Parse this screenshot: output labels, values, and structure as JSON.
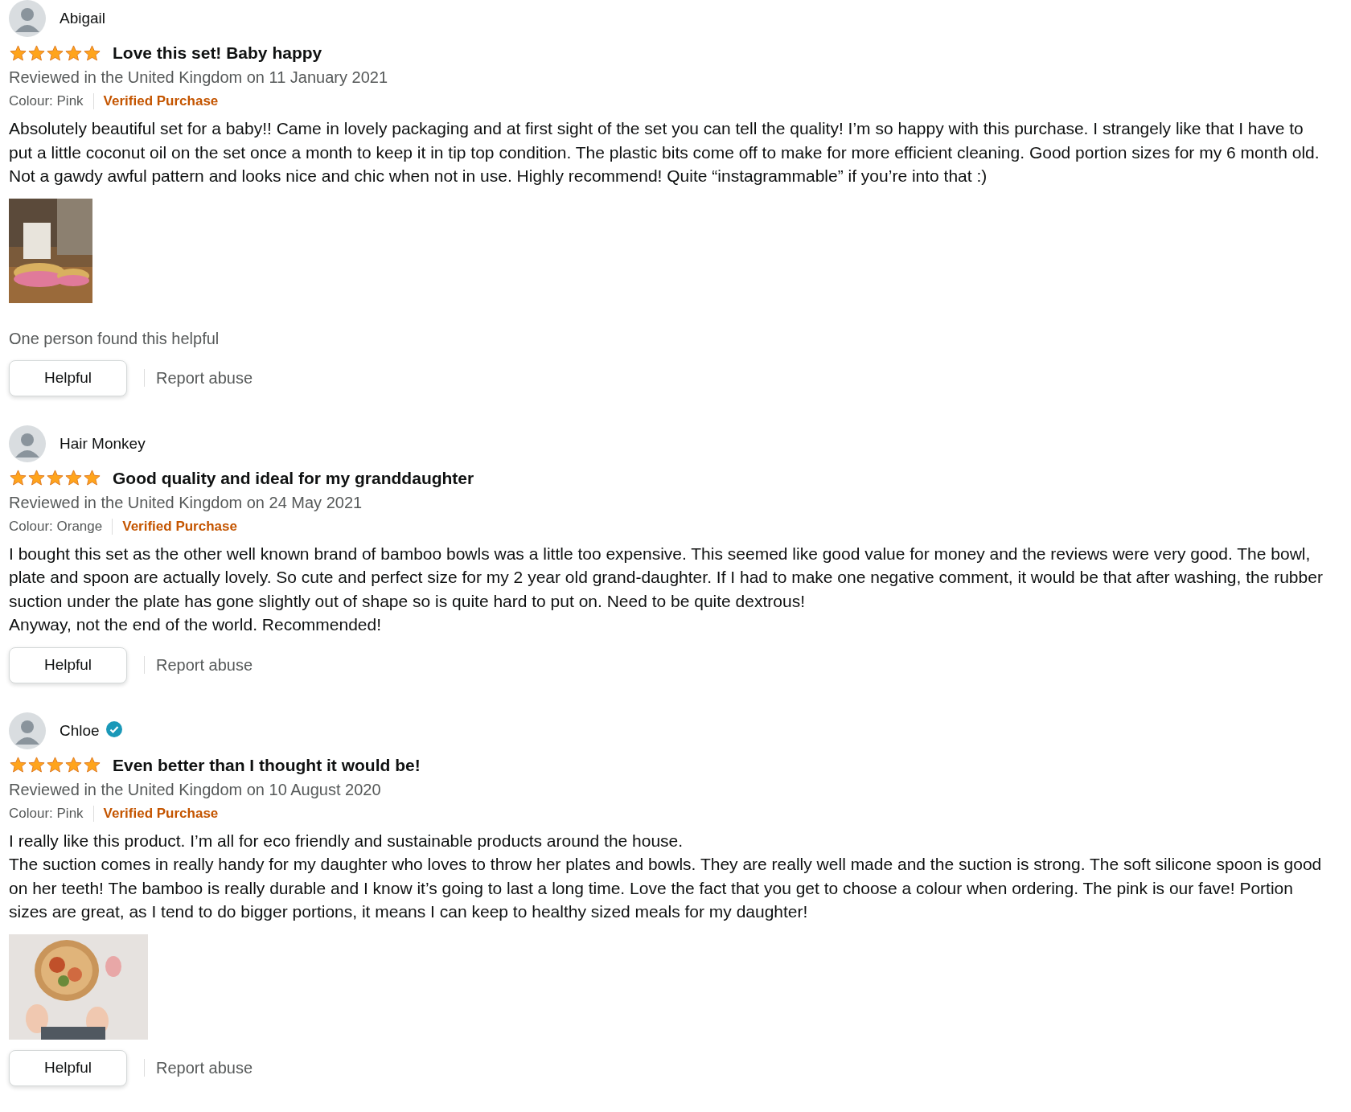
{
  "reviews": [
    {
      "author": "Abigail",
      "author_verified": false,
      "stars": 5,
      "title": "Love this set! Baby happy",
      "date": "Reviewed in the United Kingdom on 11 January 2021",
      "colour": "Colour: Pink",
      "purchase": "Verified Purchase",
      "body": [
        "Absolutely beautiful set for a baby!! Came in lovely packaging and at first sight of the set you can tell the quality! I’m so happy with this purchase. I strangely like that I have to put a little coconut oil on the set once a month to keep it in tip top condition. The plastic bits come off to make for more efficient cleaning. Good portion sizes for my 6 month old. Not a gawdy awful pattern and looks nice and chic when not in use. Highly recommend! Quite “instagrammable” if you’re into that :)"
      ],
      "image": {
        "kind": "tabletop"
      },
      "helpful_count": "One person found this helpful",
      "helpful_button": "Helpful",
      "report": "Report abuse"
    },
    {
      "author": "Hair Monkey",
      "author_verified": false,
      "stars": 5,
      "title": "Good quality and ideal for my granddaughter",
      "date": "Reviewed in the United Kingdom on 24 May 2021",
      "colour": "Colour: Orange",
      "purchase": "Verified Purchase",
      "body": [
        "I bought this set as the other well known brand of bamboo bowls was a little too expensive. This seemed like good value for money and the reviews were very good. The bowl, plate and spoon are actually lovely. So cute and perfect size for my 2 year old grand-daughter. If I had to make one negative comment, it would be that after washing, the rubber suction under the plate has gone slightly out of shape so is quite hard to put on. Need to be quite dextrous!",
        "Anyway, not the end of the world. Recommended!"
      ],
      "helpful_button": "Helpful",
      "report": "Report abuse"
    },
    {
      "author": "Chloe",
      "author_verified": true,
      "stars": 5,
      "title": "Even better than I thought it would be!",
      "date": "Reviewed in the United Kingdom on 10 August 2020",
      "colour": "Colour: Pink",
      "purchase": "Verified Purchase",
      "body": [
        "I really like this product. I’m all for eco friendly and sustainable products around the house.",
        "The suction comes in really handy for my daughter who loves to throw her plates and bowls. They are really well made and the suction is strong. The soft silicone spoon is good on her teeth! The bamboo is really durable and I know it’s going to last a long time. Love the fact that you get to choose a colour when ordering. The pink is our fave! Portion sizes are great, as I tend to do bigger portions, it means I can keep to healthy sized meals for my daughter!"
      ],
      "image": {
        "kind": "overhead"
      },
      "helpful_button": "Helpful",
      "report": "Report abuse"
    }
  ]
}
